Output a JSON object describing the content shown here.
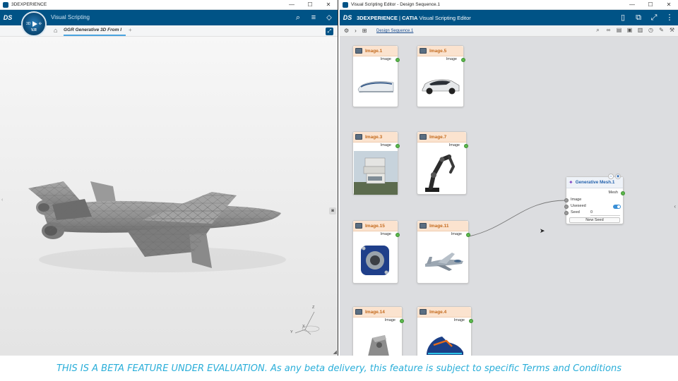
{
  "left_window": {
    "title": "3DEXPERIENCE",
    "app_title": "Visual Scripting",
    "compass": {
      "top_label": "3D",
      "bottom_label": "V.R"
    },
    "doc_tab": "GGR Generative 3D From I",
    "add_tab": "+",
    "axes": {
      "z": "Z",
      "y": "Y",
      "x": "X"
    }
  },
  "right_window": {
    "title": "Visual Scripting Editor - Design Sequence.1",
    "brand": {
      "prefix": "3DEXPERIENCE",
      "sep": " | ",
      "product": "CATIA",
      "suffix": " Visual Scripting Editor"
    },
    "breadcrumb": "Design Sequence.1",
    "nodes": [
      {
        "title": "Image.1",
        "port": "Image",
        "content": "train"
      },
      {
        "title": "Image.5",
        "port": "Image",
        "content": "car"
      },
      {
        "title": "Image.3",
        "port": "Image",
        "content": "building"
      },
      {
        "title": "Image.7",
        "port": "Image",
        "content": "robot-arm"
      },
      {
        "title": "Image.15",
        "port": "Image",
        "content": "bearing"
      },
      {
        "title": "Image.11",
        "port": "Image",
        "content": "jet"
      },
      {
        "title": "Image.14",
        "port": "Image",
        "content": "bracket"
      },
      {
        "title": "Image.4",
        "port": "Image",
        "content": "sneaker"
      }
    ],
    "generative_node": {
      "title": "Generative Mesh.1",
      "output": "Mesh",
      "inputs": [
        "Image",
        "Useseed",
        "Seed"
      ],
      "seed_value": "0",
      "useseed_enabled": true,
      "button": "New Seed"
    }
  },
  "window_controls": {
    "minimize": "—",
    "maximize": "☐",
    "close": "✕"
  },
  "banner": "THIS IS A BETA FEATURE UNDER EVALUATION. As any beta delivery, this feature is subject to specific Terms and Conditions",
  "colors": {
    "appbar": "#005386",
    "node_header": "#fbe3cf",
    "node_title": "#c46b1e",
    "port": "#5cb84c",
    "banner_text": "#2aaed9"
  }
}
